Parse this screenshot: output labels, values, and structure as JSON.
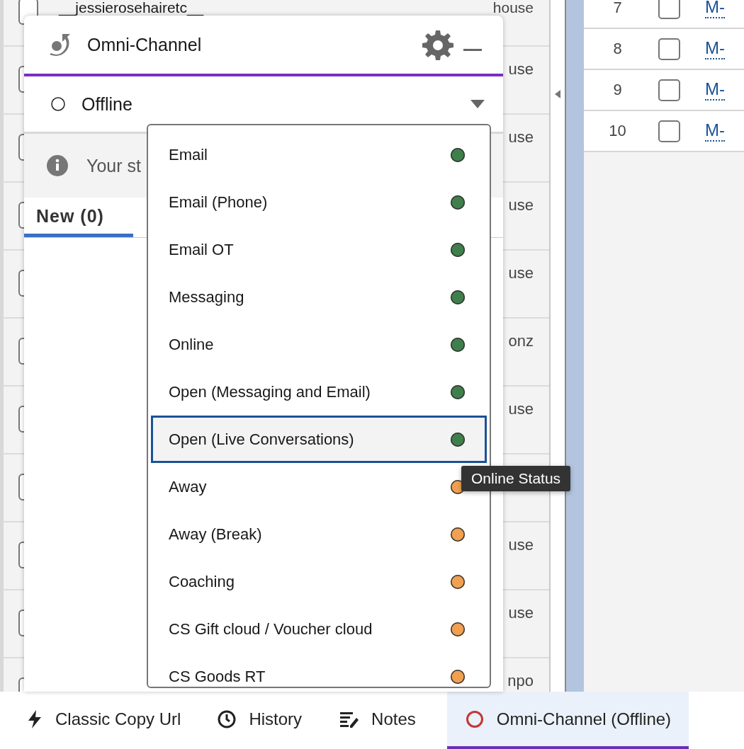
{
  "background_table": {
    "rows": [
      {
        "name": "__jessierosehairetc__",
        "column_2": "house",
        "checked": false
      },
      {
        "column_2": "use",
        "checked": false
      },
      {
        "column_2": "use",
        "checked": false
      },
      {
        "column_2": "use",
        "checked": false
      },
      {
        "column_2": "use",
        "checked": false
      },
      {
        "column_2": "onz",
        "checked": false
      },
      {
        "column_2": "use",
        "checked": false
      },
      {
        "checked": false
      },
      {
        "column_2": "use",
        "checked": false
      },
      {
        "column_2": "use",
        "checked": false
      },
      {
        "column_2": "npo",
        "checked": false
      }
    ]
  },
  "right_table": {
    "rows": [
      {
        "number": "7",
        "checked": false,
        "link": "M-"
      },
      {
        "number": "8",
        "checked": false,
        "link": "M-"
      },
      {
        "number": "9",
        "checked": false,
        "link": "M-"
      },
      {
        "number": "10",
        "checked": false,
        "link": "M-"
      }
    ]
  },
  "omni_channel_panel": {
    "title": "Omni-Channel",
    "status": "Offline",
    "info_text": "Your st",
    "tabs": [
      {
        "label": "New (0)",
        "selected": true
      }
    ]
  },
  "status_dropdown": {
    "items": [
      {
        "label": "Email",
        "color": "#3f7f4b",
        "selected": false
      },
      {
        "label": "Email (Phone)",
        "color": "#3f7f4b",
        "selected": false
      },
      {
        "label": "Email OT",
        "color": "#3f7f4b",
        "selected": false
      },
      {
        "label": "Messaging",
        "color": "#3f7f4b",
        "selected": false
      },
      {
        "label": "Online",
        "color": "#3f7f4b",
        "selected": false
      },
      {
        "label": "Open (Messaging and Email)",
        "color": "#3f7f4b",
        "selected": false
      },
      {
        "label": "Open (Live Conversations)",
        "color": "#3f7f4b",
        "selected": true
      },
      {
        "label": "Away",
        "color": "#f0a050",
        "selected": false
      },
      {
        "label": "Away (Break)",
        "color": "#f0a050",
        "selected": false
      },
      {
        "label": "Coaching",
        "color": "#f0a050",
        "selected": false
      },
      {
        "label": "CS Gift cloud / Voucher cloud",
        "color": "#f0a050",
        "selected": false
      },
      {
        "label": "CS Goods RT",
        "color": "#f0a050",
        "selected": false
      }
    ]
  },
  "tooltip": "Online Status",
  "utility_bar": {
    "items": [
      {
        "kind": "bolt",
        "label": "Classic Copy Url",
        "selected": false
      },
      {
        "kind": "clock",
        "label": "History",
        "selected": false
      },
      {
        "kind": "notes",
        "label": "Notes",
        "selected": false
      },
      {
        "kind": "status",
        "label": "Omni-Channel (Offline)",
        "selected": true
      }
    ]
  }
}
